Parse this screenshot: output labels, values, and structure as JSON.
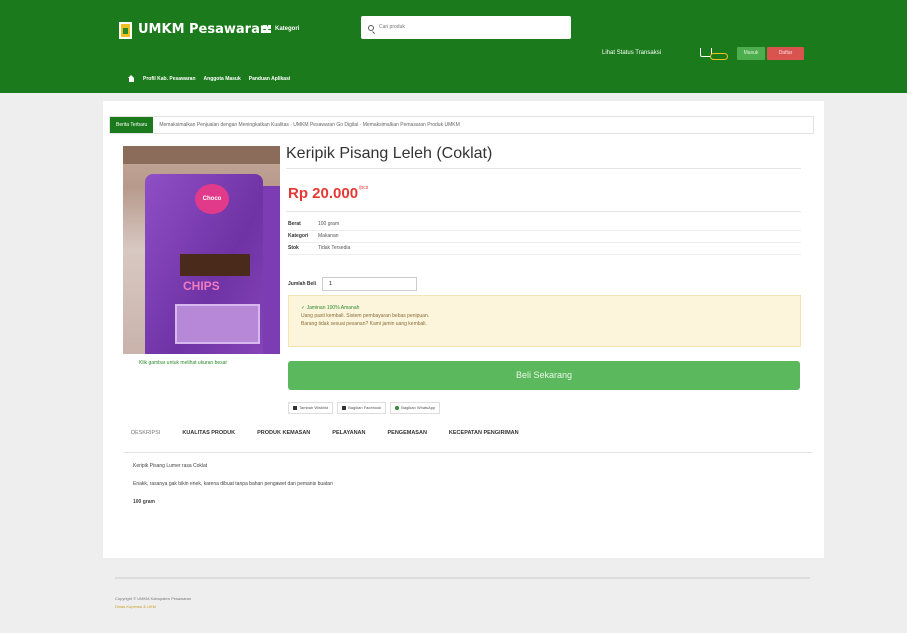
{
  "header": {
    "brand": "UMKM Pesawaran",
    "kategori": "Kategori",
    "search_placeholder": "Cari produk",
    "status_link": "Lihat Status Transaksi",
    "login": "Masuk",
    "register": "Daftar",
    "nav": [
      "Profil Kab. Pesawaran",
      "Anggota Masuk",
      "Panduan Aplikasi"
    ]
  },
  "ticker": {
    "label": "Berita Terbaru",
    "text": "Memaksimalkan Penjualan dengan Meningkatkan Kualitas  ·  UMKM Pesawaran Go Digital  ·  Memaksimalkan Pemasaran Produk UMKM"
  },
  "product": {
    "title": "Keripik Pisang Leleh (Coklat)",
    "price": "Rp 20.000",
    "price_unit": "/pcs",
    "specs": [
      {
        "k": "Berat",
        "v": "100 gram"
      },
      {
        "k": "Kategori",
        "v": "Makanan"
      },
      {
        "k": "Stok",
        "v": "Tidak Tersedia"
      }
    ],
    "qty_label": "Jumlah Beli",
    "qty_value": "1",
    "image_caption": "Klik gambar untuk melihat ukuran besar",
    "image_text_1": "Choco",
    "image_text_2": "CHIPS"
  },
  "notice": {
    "line1": "✓ Jaminan 100% Amanah",
    "line2": "Uang pasti kembali. Sistem pembayaran bebas penipuan.",
    "line3": "Barang tidak sesuai pesanan? Kami jamin uang kembali."
  },
  "buy_button": "Beli Sekarang",
  "share": [
    "Tambah Wishlist",
    "Bagikan Facebook",
    "Bagikan WhatsApp"
  ],
  "tabs": [
    "DESKRIPSI",
    "KUALITAS PRODUK",
    "PRODUK KEMASAN",
    "PELAYANAN",
    "PENGEMASAN",
    "KECEPATAN PENGIRIMAN"
  ],
  "description": [
    "Keripik Pisang Lumer rasa Coklat",
    "Enakk, rasanya gak bikin enek, karena dibuat tanpa bahan pengawet dan pemanis buatan",
    "100 gram"
  ],
  "footer": {
    "copy": "Copyright © UMKM Kabupaten Pesawaran",
    "link": "Dinas Koperasi & UKM"
  }
}
